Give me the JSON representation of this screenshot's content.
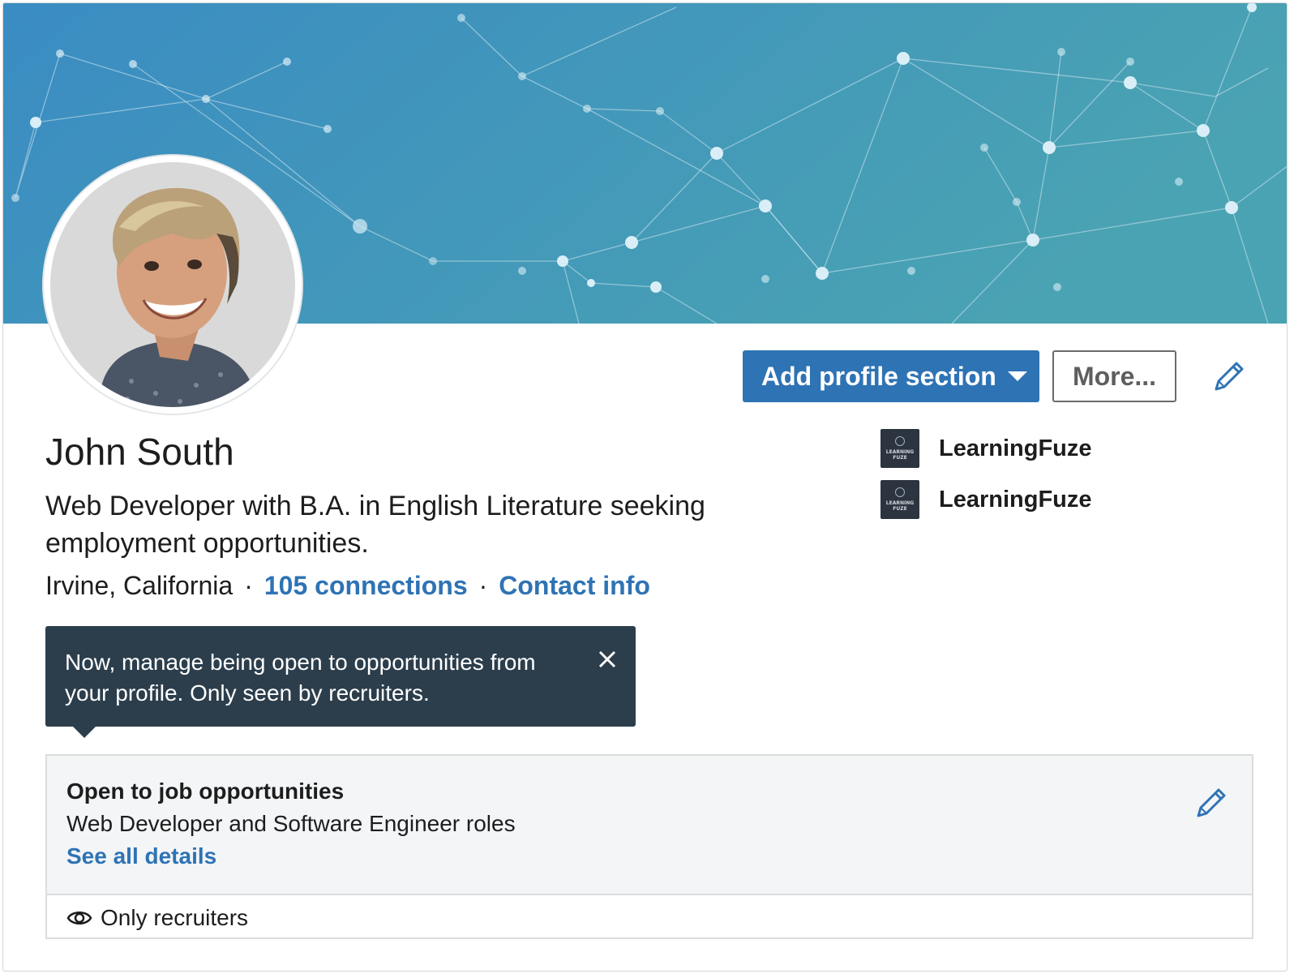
{
  "profile": {
    "name": "John South",
    "headline": "Web Developer with B.A. in English Literature seeking employment opportunities.",
    "location": "Irvine, California",
    "connections": "105 connections",
    "contact": "Contact info",
    "separator": "·"
  },
  "actions": {
    "add_section": "Add profile section",
    "more": "More..."
  },
  "companies": [
    {
      "name": "LearningFuze",
      "logo_text": "LEARNING FUZE"
    },
    {
      "name": "LearningFuze",
      "logo_text": "LEARNING FUZE"
    }
  ],
  "tooltip": {
    "text": "Now, manage being open to opportunities from your profile. Only seen by recruiters."
  },
  "open_to_work": {
    "title": "Open to job opportunities",
    "roles": "Web Developer and Software Engineer roles",
    "details_link": "See all details",
    "visibility": "Only recruiters"
  },
  "colors": {
    "brand_blue": "#2e73b4",
    "tooltip_bg": "#2c3e4c",
    "banner_start": "#3b8fc0",
    "banner_end": "#4aa1b3"
  },
  "icons": [
    "caret-down-icon",
    "pencil-icon",
    "close-icon",
    "eye-icon"
  ]
}
